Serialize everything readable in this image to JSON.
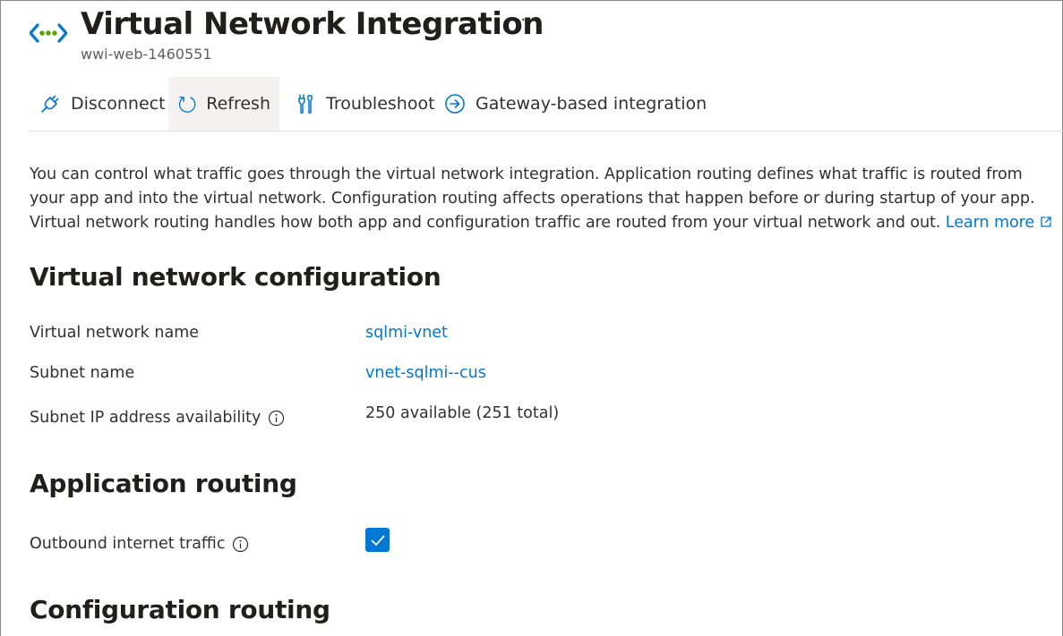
{
  "header": {
    "title": "Virtual Network Integration",
    "subtitle": "wwi-web-1460551",
    "more_label": "···"
  },
  "toolbar": {
    "disconnect_label": "Disconnect",
    "refresh_label": "Refresh",
    "troubleshoot_label": "Troubleshoot",
    "gateway_label": "Gateway-based integration"
  },
  "description": {
    "text": "You can control what traffic goes through the virtual network integration. Application routing defines what traffic is routed from your app and into the virtual network. Configuration routing affects operations that happen before or during startup of your app. Virtual network routing handles how both app and configuration traffic are routed from your virtual network and out.",
    "learn_more": "Learn more"
  },
  "vnet_config": {
    "title": "Virtual network configuration",
    "rows": [
      {
        "label": "Virtual network name",
        "value": "sqlmi-vnet"
      },
      {
        "label": "Subnet name",
        "value": "vnet-sqlmi--cus"
      },
      {
        "label": "Subnet IP address availability",
        "value": "250 available (251 total)"
      }
    ]
  },
  "app_routing": {
    "title": "Application routing",
    "outbound_label": "Outbound internet traffic",
    "outbound_checked": true
  },
  "config_routing": {
    "title": "Configuration routing"
  },
  "colors": {
    "accent": "#0078d4",
    "text": "#323130",
    "icon_green": "#57a300"
  },
  "icons": {
    "resource": "vnet-icon",
    "disconnect": "plug-icon",
    "refresh": "refresh-icon",
    "troubleshoot": "wrench-icon",
    "gateway": "arrow-circle-icon",
    "external": "external-link-icon",
    "info": "info-icon",
    "check": "checkmark-icon"
  }
}
